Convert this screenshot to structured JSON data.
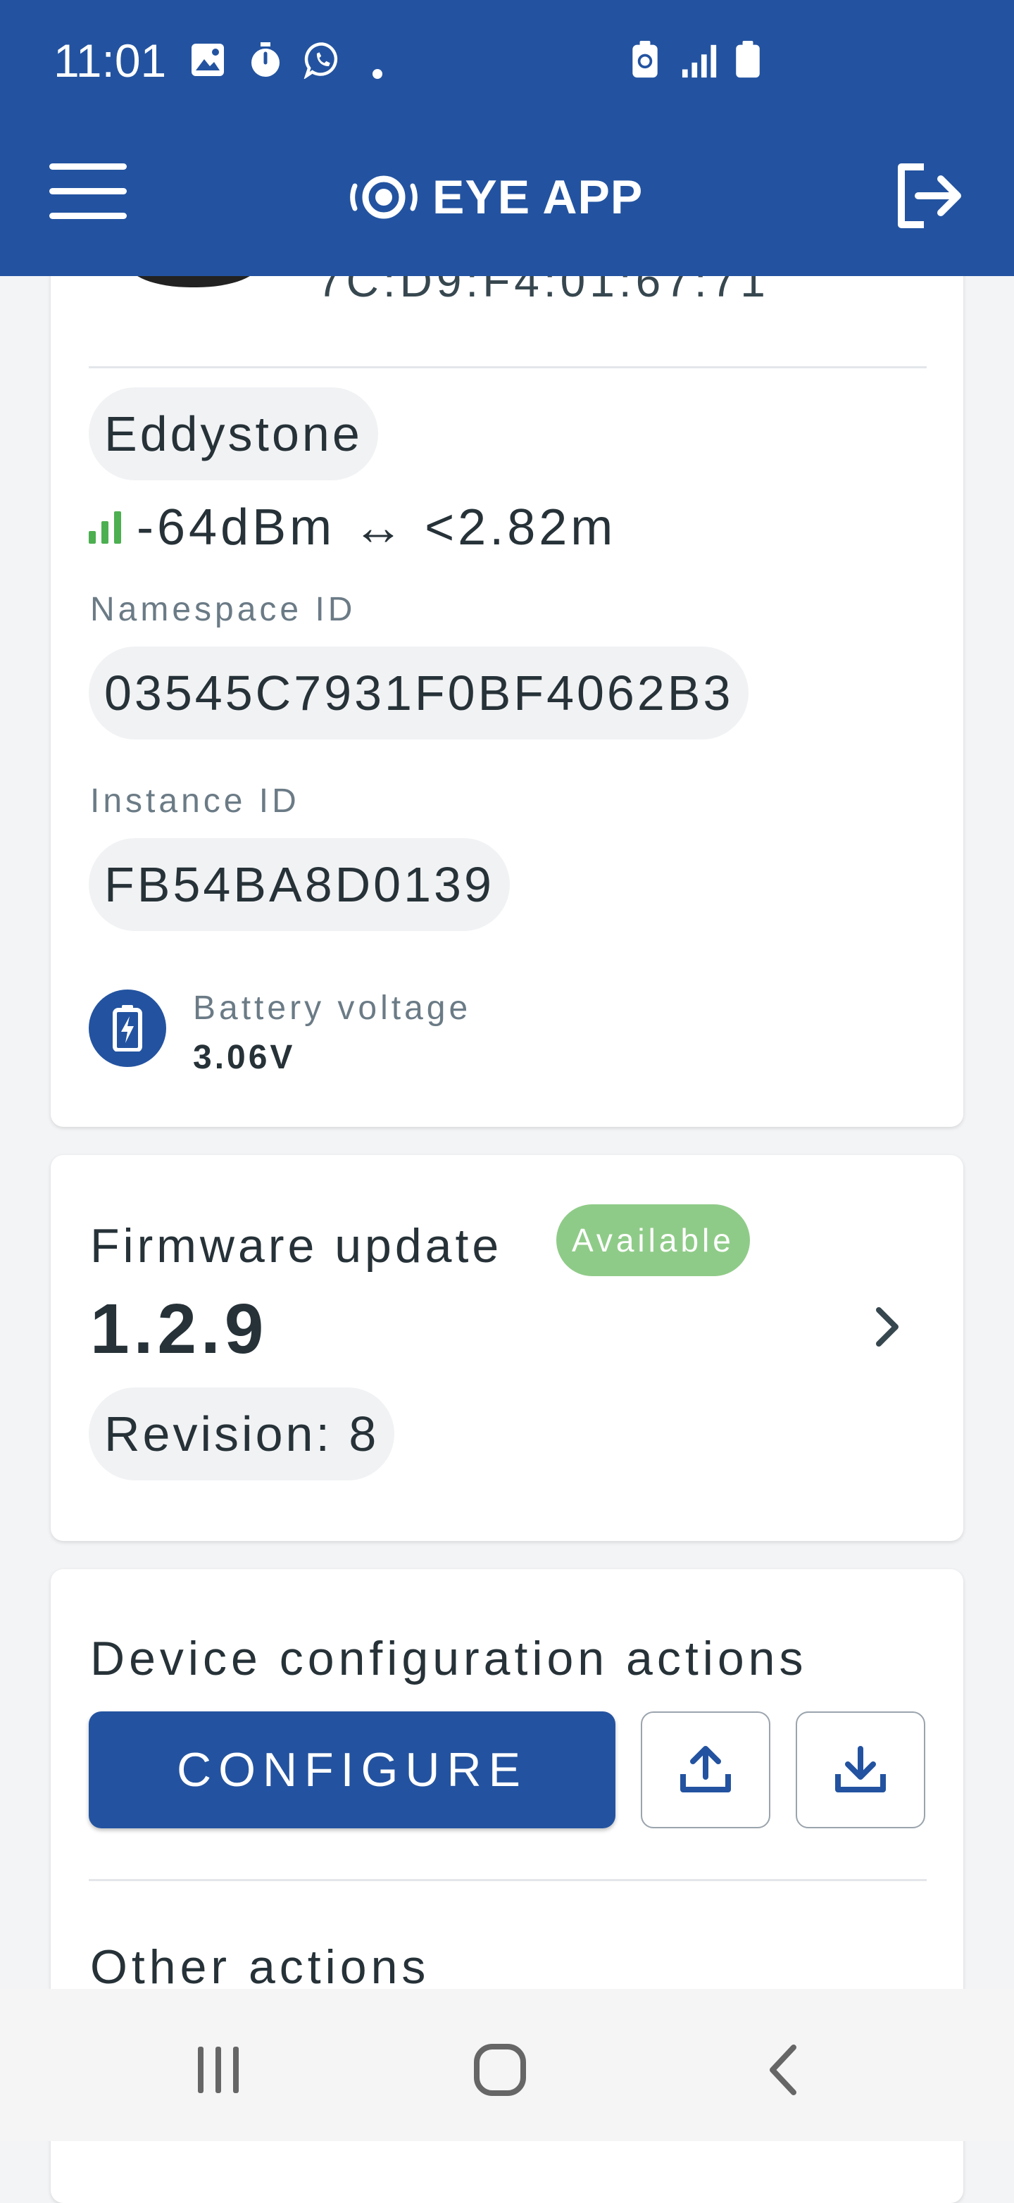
{
  "status_bar": {
    "time": "11:01",
    "left_icons": [
      "image-icon",
      "timer-icon",
      "whatsapp-icon",
      "dot-icon"
    ],
    "right_icons": [
      "battery-saver-icon",
      "signal-icon",
      "battery-icon"
    ]
  },
  "app_bar": {
    "title": "EYE APP",
    "menu_icon": "hamburger-menu-icon",
    "logout_icon": "logout-icon"
  },
  "device_card": {
    "mac_partial": "7C:D9:F4:01:67:71",
    "protocol": "Eddystone",
    "rssi_text": "-64dBm ↔ <2.82m",
    "namespace_label": "Namespace ID",
    "namespace_value": "03545C7931F0BF4062B3",
    "instance_label": "Instance ID",
    "instance_value": "FB54BA8D0139",
    "battery_label": "Battery voltage",
    "battery_value": "3.06V"
  },
  "firmware_card": {
    "title": "Firmware update",
    "badge": "Available",
    "version": "1.2.9",
    "revision": "Revision: 8"
  },
  "config_card": {
    "title": "Device configuration actions",
    "configure_label": "CONFIGURE",
    "other_title": "Other actions"
  },
  "colors": {
    "brand": "#2353a0",
    "available_badge": "#8fcb88",
    "signal": "#4caf50"
  },
  "nav_bar": {
    "buttons": [
      "recent-apps-icon",
      "home-icon",
      "back-icon"
    ]
  }
}
